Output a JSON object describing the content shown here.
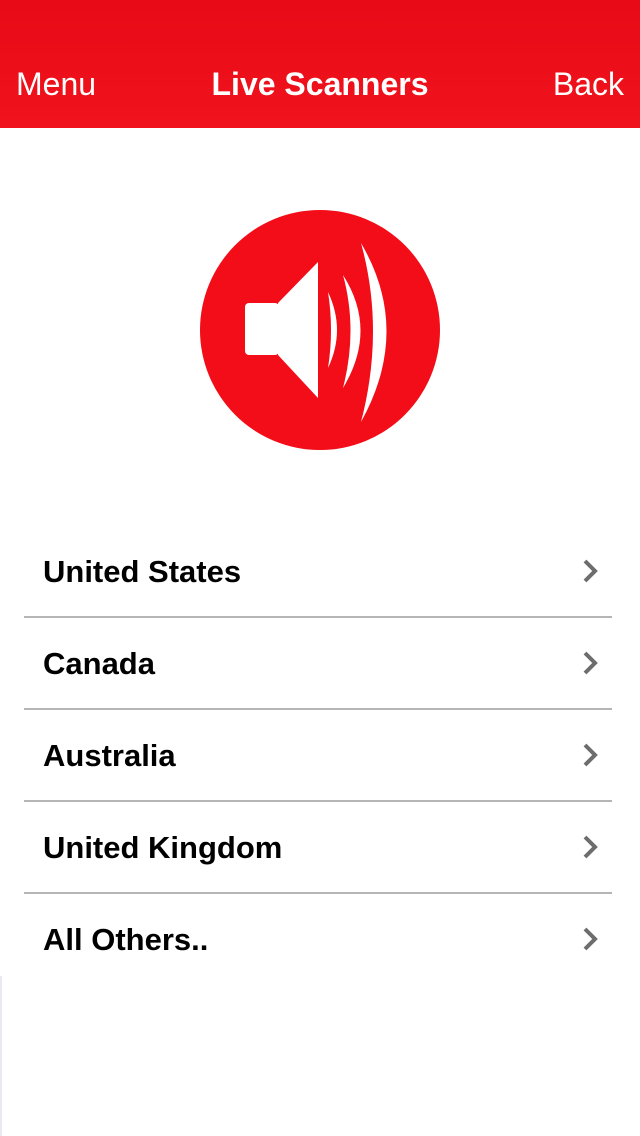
{
  "navbar": {
    "left_label": "Menu",
    "title": "Live Scanners",
    "right_label": "Back",
    "background_color": "#ee1019",
    "text_color": "#ffffff"
  },
  "logo": {
    "icon": "speaker-volume-icon",
    "color": "#f20d18"
  },
  "regions": [
    {
      "label": "United States"
    },
    {
      "label": "Canada"
    },
    {
      "label": "Australia"
    },
    {
      "label": "United Kingdom"
    },
    {
      "label": "All Others.."
    }
  ],
  "chevron": {
    "icon": "chevron-right-icon",
    "color": "#6d6d6d"
  }
}
